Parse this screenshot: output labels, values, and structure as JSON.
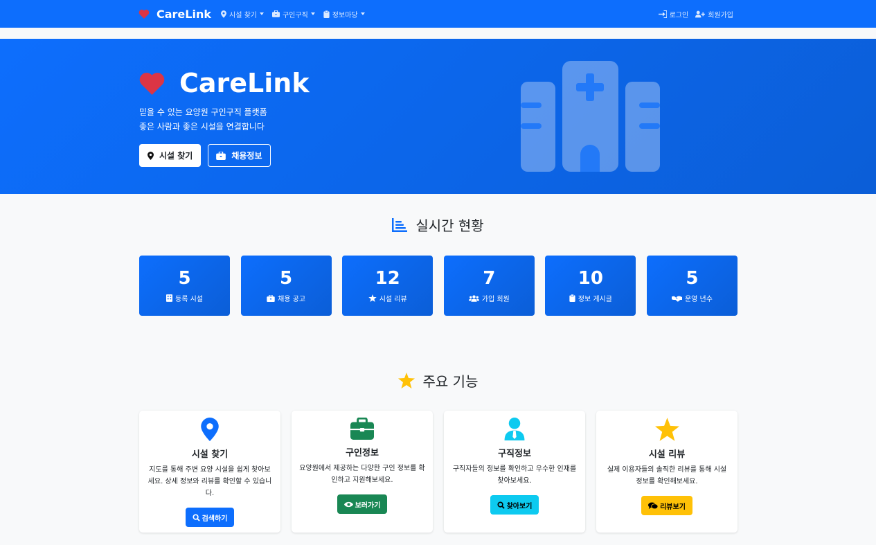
{
  "navbar": {
    "brand": "CareLink",
    "items": [
      {
        "label": "시설 찾기",
        "icon": "map-pin-icon"
      },
      {
        "label": "구인구직",
        "icon": "briefcase-icon"
      },
      {
        "label": "정보마당",
        "icon": "clipboard-icon"
      }
    ],
    "login": "로그인",
    "signup": "회원가입"
  },
  "hero": {
    "title": "CareLink",
    "subtitle_line1": "믿을 수 있는 요양원 구인구직 플랫폼",
    "subtitle_line2": "좋은 사람과 좋은 시설을 연결합니다",
    "btn_find": "시설 찾기",
    "btn_jobs": "채용정보"
  },
  "stats_section": {
    "title": "실시간 현황",
    "items": [
      {
        "value": "5",
        "label": "등록 시설",
        "icon": "building-icon"
      },
      {
        "value": "5",
        "label": "채용 공고",
        "icon": "briefcase-icon"
      },
      {
        "value": "12",
        "label": "시설 리뷰",
        "icon": "star-icon"
      },
      {
        "value": "7",
        "label": "가입 회원",
        "icon": "users-icon"
      },
      {
        "value": "10",
        "label": "정보 게시글",
        "icon": "clipboard-icon"
      },
      {
        "value": "5",
        "label": "운영 년수",
        "icon": "handshake-icon"
      }
    ]
  },
  "features_section": {
    "title": "주요 기능",
    "cards": [
      {
        "title": "시설 찾기",
        "desc": "지도를 통해 주변 요양 시설을 쉽게 찾아보세요. 상세 정보와 리뷰를 확인할 수 있습니다.",
        "button": "검색하기",
        "color": "#0d6efd"
      },
      {
        "title": "구인정보",
        "desc": "요양원에서 제공하는 다양한 구인 정보를 확인하고 지원해보세요.",
        "button": "보러가기",
        "color": "#198754"
      },
      {
        "title": "구직정보",
        "desc": "구직자들의 정보를 확인하고 우수한 인재를 찾아보세요.",
        "button": "찾아보기",
        "color": "#0dcaf0"
      },
      {
        "title": "시설 리뷰",
        "desc": "실제 이용자들의 솔직한 리뷰를 통해 시설 정보를 확인해보세요.",
        "button": "리뷰보기",
        "color": "#ffc107"
      }
    ]
  }
}
